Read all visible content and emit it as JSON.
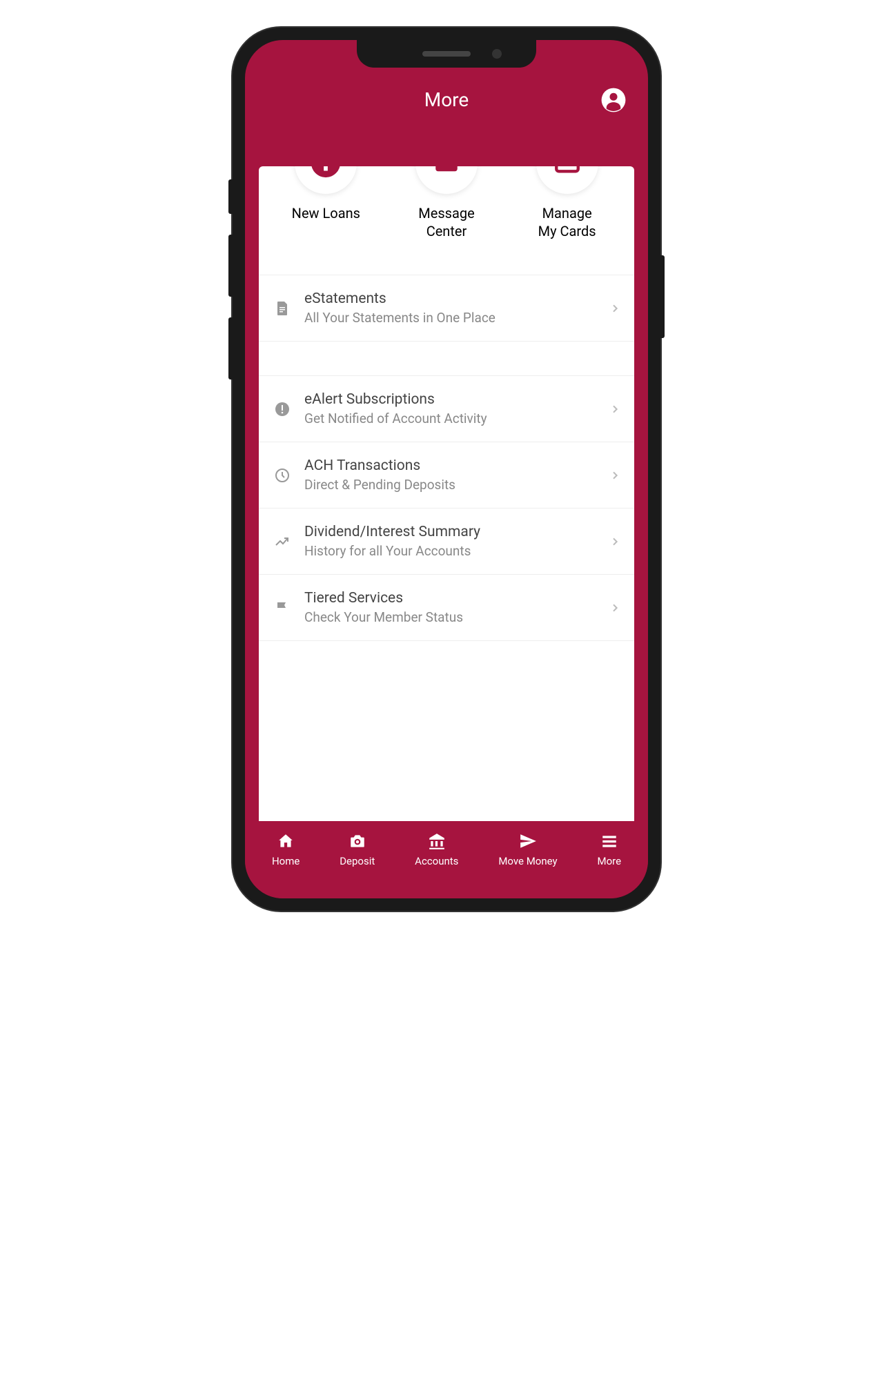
{
  "colors": {
    "brand": "#a6143f"
  },
  "header": {
    "title": "More"
  },
  "quickActions": [
    {
      "label": "New Loans",
      "icon": "plus"
    },
    {
      "label": "Message\nCenter",
      "icon": "mail"
    },
    {
      "label": "Manage\nMy Cards",
      "icon": "card"
    }
  ],
  "list1": [
    {
      "title": "eStatements",
      "subtitle": "All Your Statements in One Place",
      "icon": "document"
    }
  ],
  "list2": [
    {
      "title": "eAlert Subscriptions",
      "subtitle": "Get Notified of Account Activity",
      "icon": "alert"
    },
    {
      "title": "ACH Transactions",
      "subtitle": "Direct & Pending Deposits",
      "icon": "clock"
    },
    {
      "title": "Dividend/Interest Summary",
      "subtitle": "History for all Your Accounts",
      "icon": "trend"
    },
    {
      "title": "Tiered Services",
      "subtitle": "Check Your Member Status",
      "icon": "flag"
    }
  ],
  "bottomNav": [
    {
      "label": "Home",
      "icon": "home"
    },
    {
      "label": "Deposit",
      "icon": "camera"
    },
    {
      "label": "Accounts",
      "icon": "bank"
    },
    {
      "label": "Move Money",
      "icon": "send"
    },
    {
      "label": "More",
      "icon": "menu"
    }
  ]
}
